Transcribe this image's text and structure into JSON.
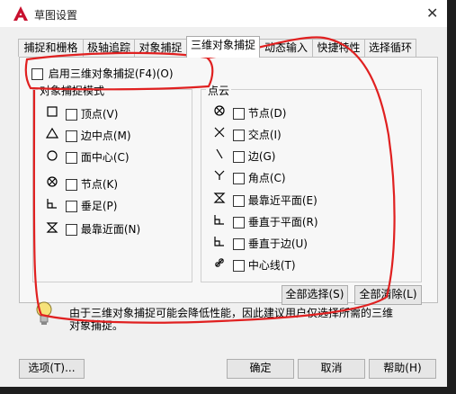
{
  "window": {
    "title": "草图设置"
  },
  "tabs": [
    "捕捉和栅格",
    "极轴追踪",
    "对象捕捉",
    "三维对象捕捉",
    "动态输入",
    "快捷特性",
    "选择循环"
  ],
  "enable_3d_snap_label": "启用三维对象捕捉(F4)(O)",
  "object_snap_modes": {
    "group_label": "对象捕捉模式",
    "items": [
      {
        "label": "顶点(V)",
        "icon": "square-icon"
      },
      {
        "label": "边中点(M)",
        "icon": "triangle-icon"
      },
      {
        "label": "面中心(C)",
        "icon": "circle-icon"
      },
      {
        "label": "节点(K)",
        "icon": "node-icon"
      },
      {
        "label": "垂足(P)",
        "icon": "perpendicular-icon"
      },
      {
        "label": "最靠近面(N)",
        "icon": "nearest-icon"
      }
    ]
  },
  "point_cloud": {
    "group_label": "点云",
    "items": [
      {
        "label": "节点(D)",
        "icon": "node-icon"
      },
      {
        "label": "交点(I)",
        "icon": "intersection-icon"
      },
      {
        "label": "边(G)",
        "icon": "edge-icon"
      },
      {
        "label": "角点(C)",
        "icon": "corner-icon"
      },
      {
        "label": "最靠近平面(E)",
        "icon": "nearest-plane-icon"
      },
      {
        "label": "垂直于平面(R)",
        "icon": "perpendicular-plane-icon"
      },
      {
        "label": "垂直于边(U)",
        "icon": "perpendicular-edge-icon"
      },
      {
        "label": "中心线(T)",
        "icon": "centerline-icon"
      }
    ]
  },
  "buttons": {
    "select_all": "全部选择(S)",
    "clear_all": "全部清除(L)",
    "options": "选项(T)...",
    "ok": "确定",
    "cancel": "取消",
    "help": "帮助(H)"
  },
  "note": "由于三维对象捕捉可能会降低性能，因此建议用户仅选择所需的三维对象捕捉。",
  "colors": {
    "annotation": "#e02020",
    "app_icon": "#c8102e"
  }
}
